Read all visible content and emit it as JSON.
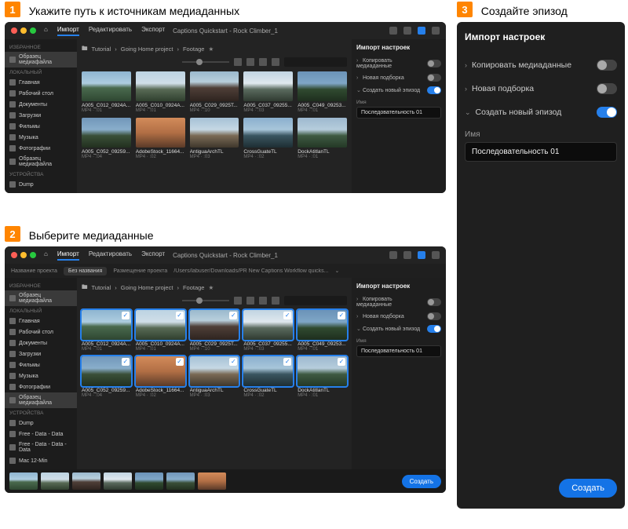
{
  "steps": {
    "s1": {
      "num": "1",
      "title": "Укажите путь к источникам медиаданных"
    },
    "s2": {
      "num": "2",
      "title": "Выберите медиаданные"
    },
    "s3": {
      "num": "3",
      "title": "Создайте эпизод"
    }
  },
  "topnav": {
    "home": "",
    "import": "Импорт",
    "edit": "Редактировать",
    "export": "Экспорт"
  },
  "project_title": "Captions Quickstart - Rock Climber_1",
  "subbar": {
    "new_project": "Название проекта",
    "untitled": "Без названия",
    "proj_path_label": "Размещение проекта",
    "proj_path": "/Users/labuser/Downloads/PR New Captions Workflow quicks..."
  },
  "breadcrumb": {
    "root_icon": "folder-icon",
    "p1": "Tutorial",
    "p2": "Going Home project",
    "p3": "Footage",
    "star": "★"
  },
  "sidebar": {
    "fav_header": "ИЗБРАННОЕ",
    "fav": [
      {
        "label": "Образец медиафайла"
      }
    ],
    "local_header": "ЛОКАЛЬНЫЙ",
    "local": [
      {
        "label": "Главная"
      },
      {
        "label": "Рабочий стол"
      },
      {
        "label": "Документы"
      },
      {
        "label": "Загрузки"
      },
      {
        "label": "Фильмы"
      },
      {
        "label": "Музыка"
      },
      {
        "label": "Фотографии"
      },
      {
        "label": "Образец медиафайла"
      }
    ],
    "dev_header": "УСТРОЙСТВА",
    "dev": [
      {
        "label": "Dump"
      }
    ],
    "dev2": [
      {
        "label": "Dump"
      },
      {
        "label": "Free - Data - Data"
      },
      {
        "label": "Free - Data - Data - Data"
      },
      {
        "label": "Mac 12-Min"
      }
    ]
  },
  "clips": [
    {
      "name": "A005_C012_0924A...",
      "meta": "MP4 · :01"
    },
    {
      "name": "A005_C010_0924A...",
      "meta": "MP4 · :01"
    },
    {
      "name": "A005_C029_0925T...",
      "meta": "MP4 · :10"
    },
    {
      "name": "A005_C037_09255...",
      "meta": "MP4 · :03"
    },
    {
      "name": "A005_C049_09253...",
      "meta": "MP4 · :01"
    },
    {
      "name": "A005_C052_09259...",
      "meta": "MP4 · :04"
    },
    {
      "name": "AdobeStock_11664...",
      "meta": "MP4 · :02"
    },
    {
      "name": "AntiguaArchTL",
      "meta": "MP4 · :03"
    },
    {
      "name": "CrossGuateTL",
      "meta": "MP4 · :02"
    },
    {
      "name": "DockAtitlanTL",
      "meta": "MP4 · :01"
    }
  ],
  "settings": {
    "title": "Импорт настроек",
    "copy": "Копировать медиаданные",
    "bin": "Новая подборка",
    "seq": "Создать новый эпизод",
    "name_label": "Имя",
    "name_value": "Последовательность 01"
  },
  "create_label": "Создать"
}
